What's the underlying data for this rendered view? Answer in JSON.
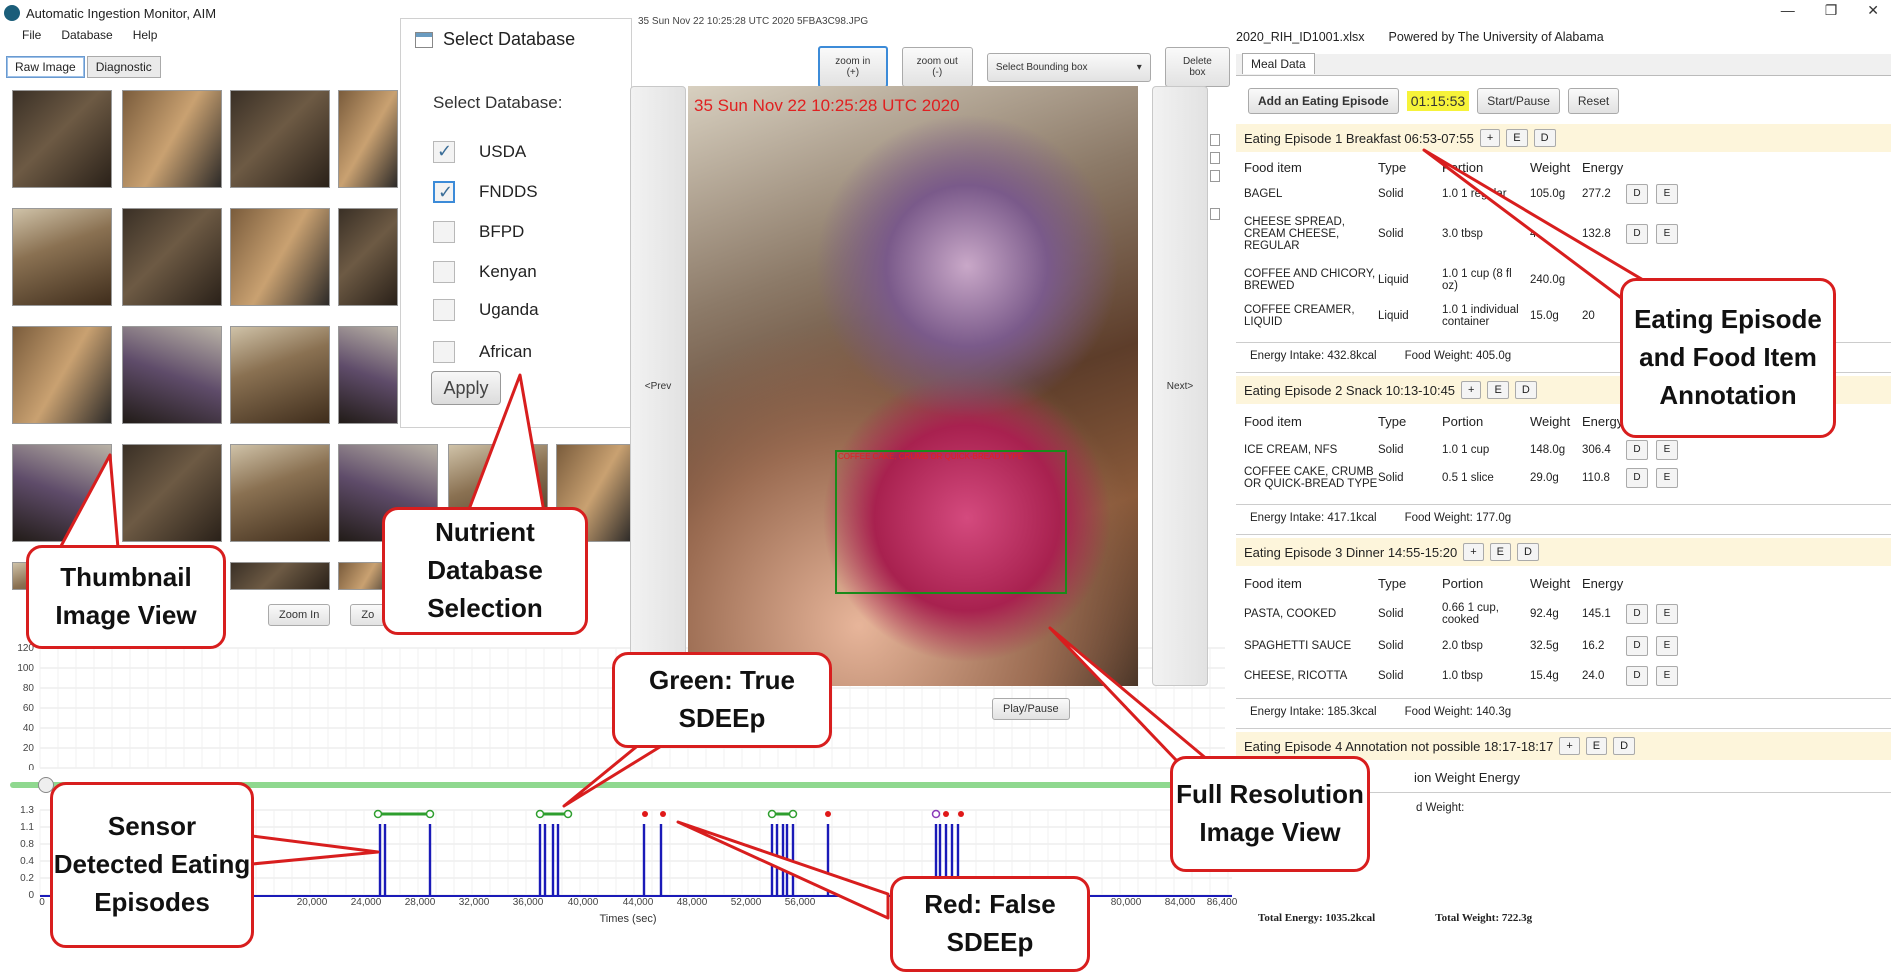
{
  "window": {
    "title": "Automatic Ingestion Monitor, AIM"
  },
  "menu": [
    "File",
    "Database",
    "Help"
  ],
  "tabs": [
    "Raw Image",
    "Diagnostic"
  ],
  "database_dialog": {
    "title": "Select Database",
    "label": "Select Database:",
    "options": [
      {
        "label": "USDA",
        "checked": true
      },
      {
        "label": "FNDDS",
        "checked": true
      },
      {
        "label": "BFPD",
        "checked": false
      },
      {
        "label": "Kenyan",
        "checked": false
      },
      {
        "label": "Uganda",
        "checked": false
      },
      {
        "label": "African",
        "checked": false
      }
    ],
    "apply": "Apply"
  },
  "thumb_controls": {
    "zoom_in": "Zoom In",
    "zoom_out": "Zo"
  },
  "plot1": {
    "yticks": [
      "120",
      "100",
      "80",
      "60",
      "40",
      "20",
      "0"
    ]
  },
  "plot2": {
    "yticks": [
      "1.3",
      "1.1",
      "0.8",
      "0.4",
      "0.2",
      "0"
    ],
    "xticks": [
      "0",
      "20,000",
      "24,000",
      "28,000",
      "32,000",
      "36,000",
      "40,000",
      "44,000",
      "48,000",
      "52,000",
      "56,000",
      "80,000",
      "84,000",
      "86,400"
    ],
    "xlabel": "Times (sec)"
  },
  "image_view": {
    "filename": "35 Sun Nov 22 10:25:28 UTC 2020 5FBA3C98.JPG",
    "zoom_in": "zoom in (+)",
    "zoom_out": "zoom out (-)",
    "select_bbox": "Select Bounding box",
    "delete_box": "Delete box",
    "prev": "<Prev",
    "next": "Next>",
    "stamp": "35 Sun Nov 22 10:25:28 UTC 2020",
    "bbox_label": "COFFEE CAKE, CRUMB OR QUICK-BREAD TYPE",
    "play_pause": "Play/Pause"
  },
  "meal": {
    "file": "2020_RIH_ID1001.xlsx",
    "powered": "Powered by The University of Alabama",
    "tab": "Meal Data",
    "add_episode": "Add an Eating Episode",
    "timer": "01:15:53",
    "start_pause": "Start/Pause",
    "reset": "Reset",
    "columns": [
      "Food item",
      "Type",
      "Portion",
      "Weight",
      "Energy"
    ],
    "episodes": [
      {
        "title": "Eating Episode 1  Breakfast 06:53-07:55",
        "items": [
          {
            "food": "BAGEL",
            "type": "Solid",
            "portion": "1.0 1 regular",
            "weight": "105.0g",
            "energy": "277.2"
          },
          {
            "food": "CHEESE SPREAD, CREAM CHEESE, REGULAR",
            "type": "Solid",
            "portion": "3.0 tbsp",
            "weight": "45.0g",
            "energy": "132.8"
          },
          {
            "food": "COFFEE AND CHICORY, BREWED",
            "type": "Liquid",
            "portion": "1.0 1 cup (8 fl oz)",
            "weight": "240.0g",
            "energy": ""
          },
          {
            "food": "COFFEE CREAMER, LIQUID",
            "type": "Liquid",
            "portion": "1.0 1 individual container",
            "weight": "15.0g",
            "energy": "20"
          }
        ],
        "energy": "Energy Intake: 432.8kcal",
        "weight": "Food Weight: 405.0g"
      },
      {
        "title": "Eating Episode 2  Snack 10:13-10:45",
        "items": [
          {
            "food": "ICE CREAM, NFS",
            "type": "Solid",
            "portion": "1.0 1 cup",
            "weight": "148.0g",
            "energy": "306.4"
          },
          {
            "food": "COFFEE CAKE, CRUMB OR QUICK-BREAD TYPE",
            "type": "Solid",
            "portion": "0.5 1 slice",
            "weight": "29.0g",
            "energy": "110.8"
          }
        ],
        "energy": "Energy Intake: 417.1kcal",
        "weight": "Food Weight: 177.0g"
      },
      {
        "title": "Eating Episode 3  Dinner 14:55-15:20",
        "items": [
          {
            "food": "PASTA, COOKED",
            "type": "Solid",
            "portion": "0.66 1 cup, cooked",
            "weight": "92.4g",
            "energy": "145.1"
          },
          {
            "food": "SPAGHETTI SAUCE",
            "type": "Solid",
            "portion": "2.0 tbsp",
            "weight": "32.5g",
            "energy": "16.2"
          },
          {
            "food": "CHEESE, RICOTTA",
            "type": "Solid",
            "portion": "1.0 tbsp",
            "weight": "15.4g",
            "energy": "24.0"
          }
        ],
        "energy": "Energy Intake: 185.3kcal",
        "weight": "Food Weight: 140.3g"
      },
      {
        "title": "Eating Episode 4  Annotation not possible 18:17-18:17",
        "partial_header": "ion  Weight  Energy",
        "partial_weight": "d Weight:"
      }
    ],
    "total_energy": "Total Energy: 1035.2kcal",
    "total_weight": "Total Weight: 722.3g"
  },
  "callouts": {
    "thumbnail": "Thumbnail Image View",
    "nutrient": "Nutrient Database Selection",
    "green": "Green: True SDEEp",
    "sensor": "Sensor Detected Eating Episodes",
    "red": "Red: False SDEEp",
    "full_res": "Full Resolution Image View",
    "annotation": "Eating Episode and Food Item Annotation"
  },
  "colors": {
    "callout_border": "#d81e1e",
    "true_episode": "#2e9e2e",
    "false_episode": "#e01818",
    "signal": "#1a1ab8",
    "timer_bg": "#f6f33a"
  }
}
